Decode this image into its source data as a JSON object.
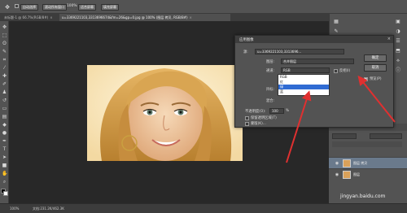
{
  "optbar": {
    "tool_icon": "move-tool-icon",
    "btn1": "自动选择",
    "btn2": "滚动所有窗口",
    "zoom": "100%",
    "btn3": "适合屏幕",
    "btn4": "填充屏幕"
  },
  "tabs": [
    {
      "label": "未标题-1 @ 66.7%(RGB/8#)",
      "close": "×"
    },
    {
      "label": "u=3369221103,3313696674&fm=26&gp=0.jpg @ 100% (图层 拷贝, RGB/8#)",
      "close": "×"
    }
  ],
  "dialog": {
    "title": "应用图像",
    "source_label": "源:",
    "source_value": "u=3369221103,3313696...",
    "layer_label": "图层:",
    "layer_value": "合并图层",
    "channel_label": "通道:",
    "channel_value": "RGB",
    "invert_label": "反相(I)",
    "target_label": "目标:",
    "blending_label": "混合:",
    "opacity_label": "不透明度(O):",
    "opacity_value": "100",
    "opacity_unit": "%",
    "preserve_label": "保留透明区域(T)",
    "mask_label": "蒙版(K)...",
    "ok_label": "确定",
    "cancel_label": "取消",
    "preview_label": "预览(P)",
    "close": "×"
  },
  "channel_options": [
    "RGB",
    "红",
    "绿",
    "蓝"
  ],
  "channel_selected_index": 2,
  "layers": [
    {
      "name": "图层 拷贝"
    },
    {
      "name": "图层"
    }
  ],
  "status": {
    "zoom": "100%",
    "doc": "文档:231.2K/462.3K"
  },
  "watermark": "jingyan.baidu.com",
  "colors": {
    "accent": "#2f6bd3",
    "arrow": "#e03030"
  }
}
